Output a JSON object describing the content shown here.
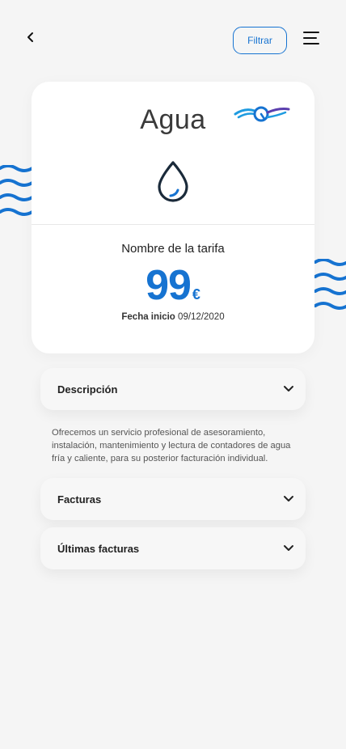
{
  "header": {
    "back_icon": "chevron-left-icon",
    "filter_label": "Filtrar",
    "menu_icon": "hamburger-menu-icon"
  },
  "card": {
    "title": "Agua",
    "logo_icon": "brand-logo-icon",
    "icon": "water-drop-icon",
    "tariff_name": "Nombre de la tarifa",
    "price": "99",
    "currency": "€",
    "date_label": "Fecha inicio",
    "date_value": "09/12/2020"
  },
  "sections": {
    "description": {
      "label": "Descripción",
      "text": "Ofrecemos un servicio profesional de asesoramiento, instalación, mantenimiento y lectura de contadores de agua fría y caliente, para su posterior facturación individual."
    },
    "invoices": {
      "label": "Facturas"
    },
    "last_invoices": {
      "label": "Últimas facturas"
    }
  },
  "colors": {
    "accent": "#1673d1",
    "background": "#f5f5f5",
    "card": "#ffffff"
  }
}
